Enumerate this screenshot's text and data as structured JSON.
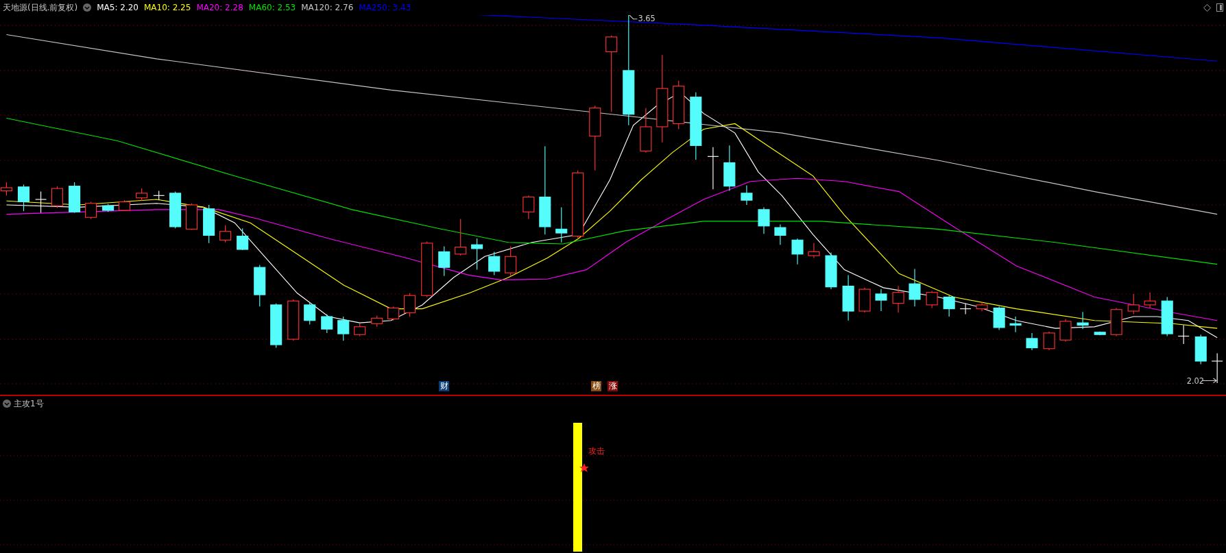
{
  "header": {
    "title": "天地源(日线.前复权)",
    "ma_legend": [
      {
        "label": "MA5: 2.20",
        "color": "#ffffff"
      },
      {
        "label": "MA10: 2.25",
        "color": "#ffff00"
      },
      {
        "label": "MA20: 2.28",
        "color": "#ff00ff"
      },
      {
        "label": "MA60: 2.53",
        "color": "#00e600"
      },
      {
        "label": "MA120: 2.76",
        "color": "#c8c8c8"
      },
      {
        "label": "MA250: 3.43",
        "color": "#0000ff"
      }
    ]
  },
  "chart": {
    "high_label": "3.65",
    "low_label": "2.02",
    "markers": [
      {
        "text": "财",
        "color": "#0a3f7a"
      },
      {
        "text": "榜",
        "color": "#8a4a10"
      },
      {
        "text": "涨",
        "color": "#8a0a0a"
      }
    ]
  },
  "indicator": {
    "title": "主攻1号",
    "signal_label": "攻击"
  }
}
